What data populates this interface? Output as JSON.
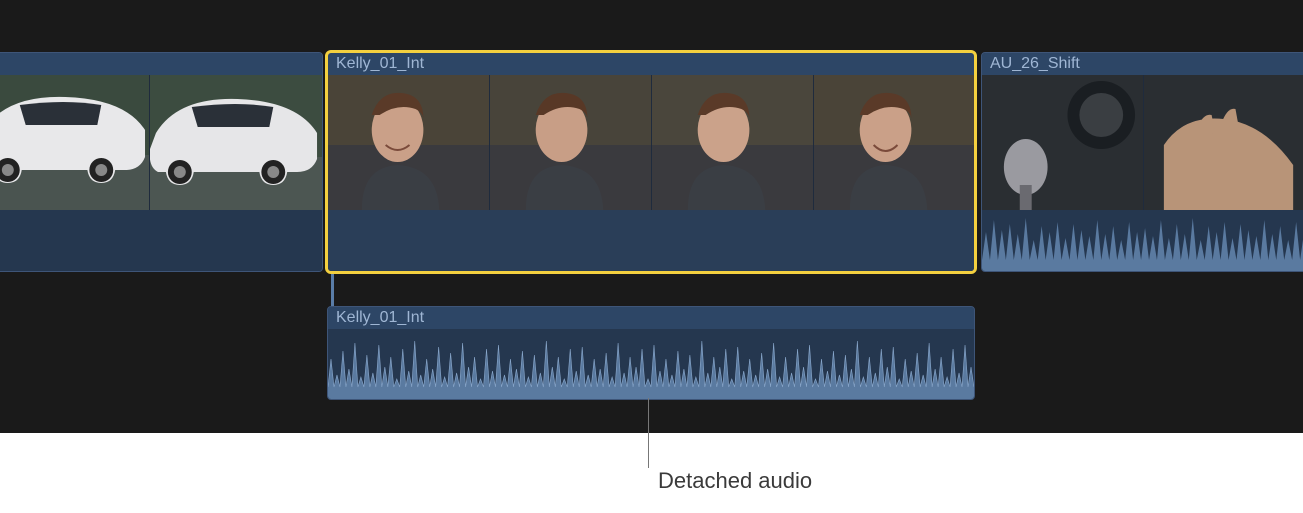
{
  "timeline": {
    "clips": [
      {
        "name": "",
        "selected": false,
        "kind": "car-on-road"
      },
      {
        "name": "Kelly_01_Int",
        "selected": true,
        "kind": "interview"
      },
      {
        "name": "AU_26_Shift",
        "selected": false,
        "kind": "gearshift"
      }
    ],
    "detached_audio": {
      "name": "Kelly_01_Int"
    }
  },
  "callout": {
    "label": "Detached audio"
  },
  "colors": {
    "selection": "#f4d03f",
    "clip_bg": "#2a3a52",
    "clip_header": "#2d4666",
    "clip_label_text": "#9fb6d4",
    "waveform": "#6a87ab",
    "waveform_fill": "#4a6384"
  }
}
